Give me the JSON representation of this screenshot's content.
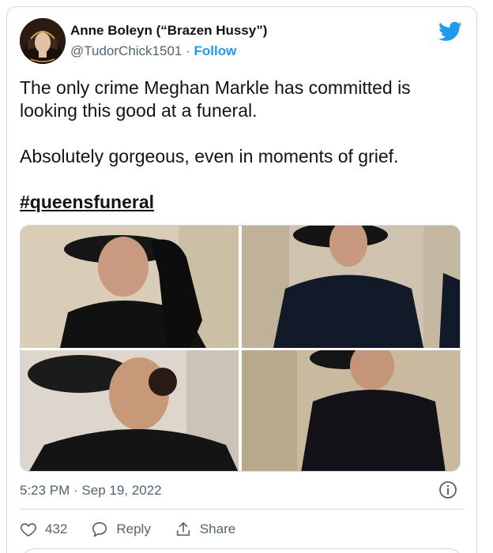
{
  "tweet": {
    "author_name": "Anne Boleyn (“Brazen Hussy”)",
    "handle": "@TudorChick1501",
    "separator": "·",
    "follow_label": "Follow",
    "paragraphs": [
      "The only crime Meghan Markle has committed is looking this good at a funeral.",
      "Absolutely gorgeous, even in moments of grief."
    ],
    "hashtag": "#queensfuneral",
    "timestamp": "5:23 PM · Sep 19, 2022",
    "like_count": "432",
    "reply_label": "Reply",
    "share_label": "Share"
  },
  "colors": {
    "accent": "#1d9bf0",
    "text_primary": "#0f1419",
    "text_secondary": "#536471",
    "border": "#cfd9de"
  },
  "icons": {
    "brand": "twitter-bird-icon",
    "info": "info-icon",
    "like": "heart-icon",
    "reply": "reply-icon",
    "share": "share-icon"
  }
}
